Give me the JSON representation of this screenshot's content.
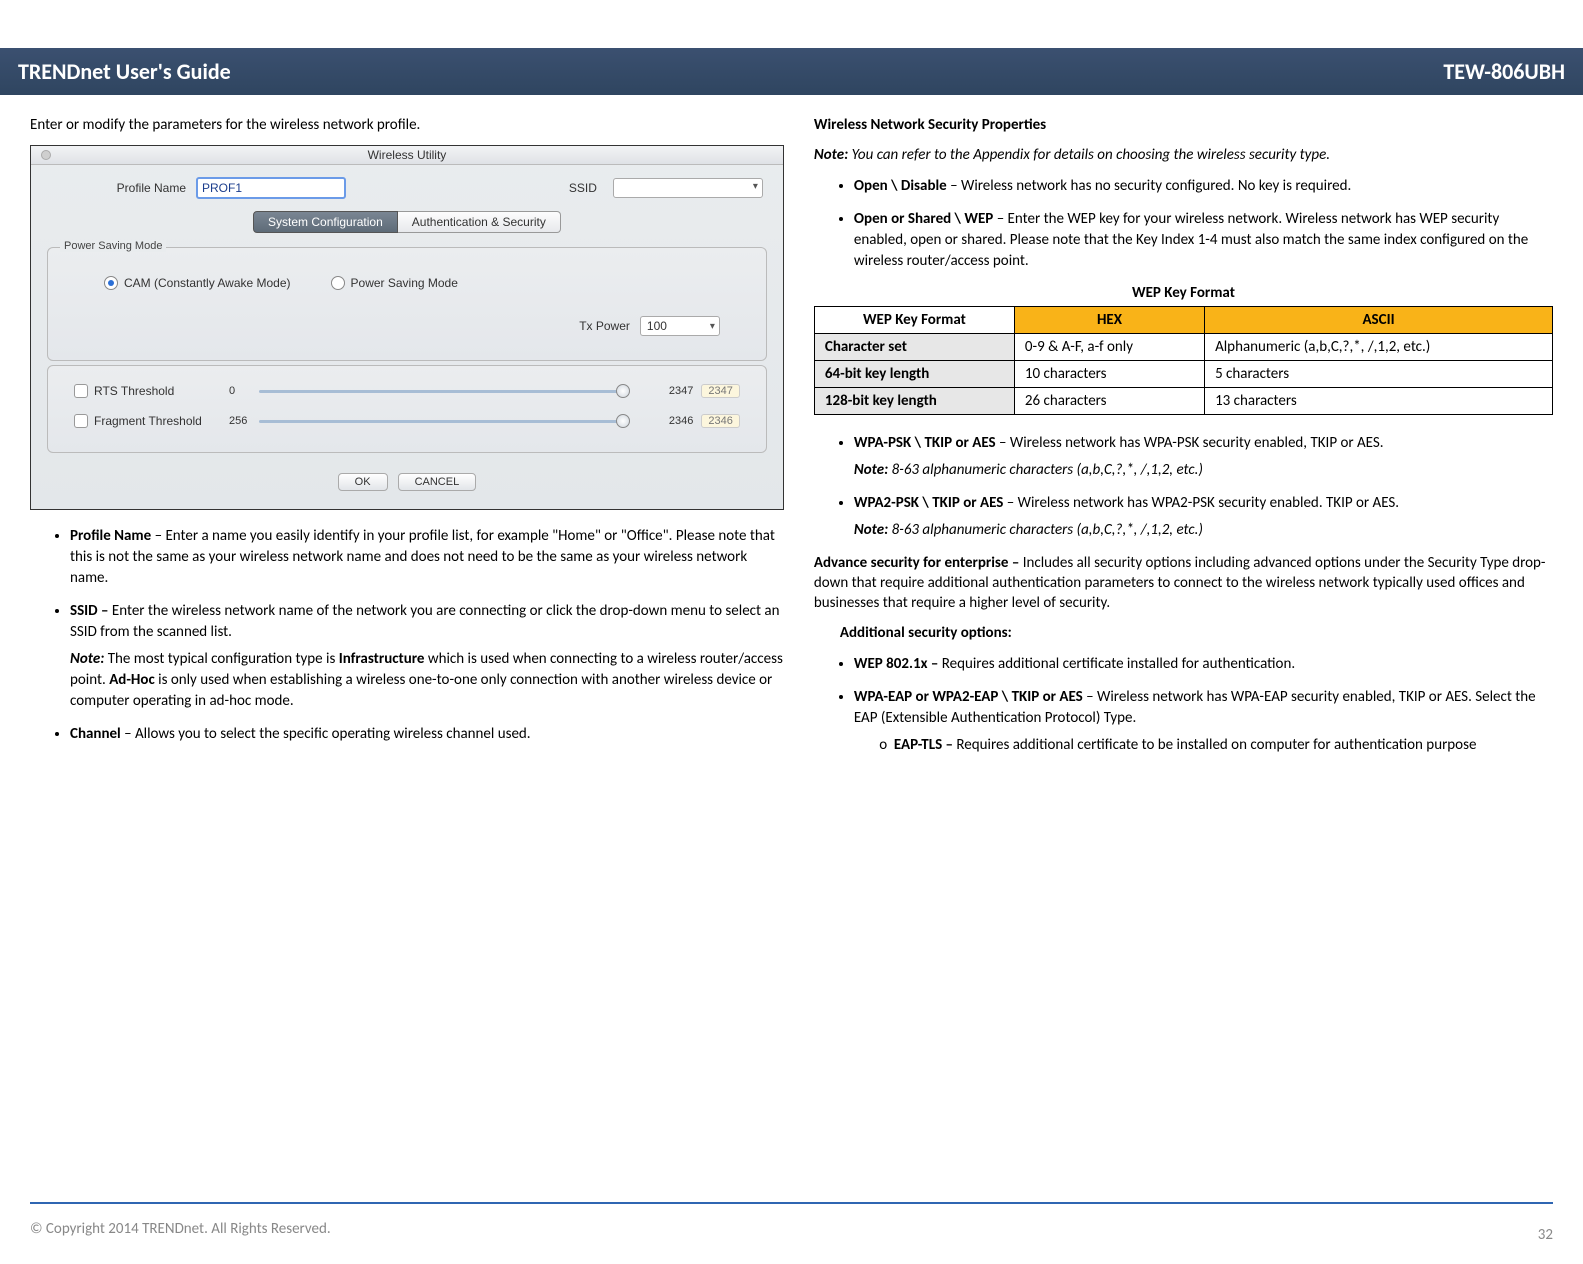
{
  "header": {
    "title": "TRENDnet User's Guide",
    "model": "TEW-806UBH"
  },
  "left": {
    "intro": "Enter or modify the parameters for the wireless network profile.",
    "shot": {
      "windowTitle": "Wireless Utility",
      "profileNameLabel": "Profile Name",
      "profileNameValue": "PROF1",
      "ssidLabel": "SSID",
      "tabSystem": "System Configuration",
      "tabAuth": "Authentication & Security",
      "powerGroupLabel": "Power Saving Mode",
      "radioCam": "CAM (Constantly Awake Mode)",
      "radioPsm": "Power Saving Mode",
      "txPowerLabel": "Tx Power",
      "txPowerValue": "100",
      "rtsLabel": "RTS Threshold",
      "fragLabel": "Fragment Threshold",
      "rtsMin": "0",
      "rtsMax": "2347",
      "rtsVal": "2347",
      "fragMin": "256",
      "fragMax": "2346",
      "fragVal": "2346",
      "okBtn": "OK",
      "cancelBtn": "CANCEL"
    },
    "bullets": {
      "profileName_h": "Profile Name",
      "profileName_b": " – Enter a name you easily identify in your profile list, for example \"Home\" or \"Office\". Please note that this is not the same as your wireless network name and does not need to be the same as your wireless network name.",
      "ssid_h": "SSID – ",
      "ssid_b": "Enter the wireless network name of the network you are connecting or click the drop-down menu to select an SSID from the scanned list.",
      "ssid_note_h": "Note:",
      "ssid_note_b1": " The most typical configuration type is ",
      "ssid_note_infra": "Infrastructure",
      "ssid_note_b2": " which is used when connecting to a wireless router/access point. ",
      "ssid_note_adhoc": "Ad-Hoc",
      "ssid_note_b3": " is only used when establishing a wireless one-to-one only connection with another wireless device or computer operating in ad-hoc mode.",
      "channel_h": "Channel",
      "channel_b": " – Allows you to select the specific operating wireless channel used."
    }
  },
  "right": {
    "h1": "Wireless Network Security Properties",
    "note_h": "Note:",
    "note_b": " You can refer to the Appendix for details on choosing the wireless security type.",
    "open_h": "Open \\ Disable",
    "open_b": " – Wireless network has no security configured. No key is required.",
    "wep_h": "Open or Shared \\ WEP",
    "wep_b": " – Enter the WEP key for your wireless network. Wireless network has WEP security enabled, open or shared. Please note that the Key Index 1-4 must also match the same index configured on the wireless router/access point.",
    "tbl_caption": "WEP Key Format",
    "tbl": {
      "h1": "WEP Key Format",
      "h2": "HEX",
      "h3": "ASCII",
      "r1c1": "Character set",
      "r1c2": "0-9 & A-F, a-f only",
      "r1c3": "Alphanumeric (a,b,C,?,*, /,1,2, etc.)",
      "r2c1": "64-bit key length",
      "r2c2": "10 characters",
      "r2c3": "5 characters",
      "r3c1": "128-bit key length",
      "r3c2": "26 characters",
      "r3c3": "13 characters"
    },
    "wpa_h": "WPA-PSK \\ TKIP or AES",
    "wpa_b": " – Wireless network has WPA-PSK security enabled, TKIP or AES.",
    "wpa_note": " 8-63 alphanumeric characters (a,b,C,?,*, /,1,2, etc.)",
    "wpa2_h": "WPA2-PSK \\ TKIP or AES",
    "wpa2_b": " – Wireless network has WPA2-PSK security  enabled. TKIP or AES.",
    "wpa2_note": " 8-63 alphanumeric characters (a,b,C,?,*, /,1,2, etc.)",
    "adv_h": "Advance security for enterprise – ",
    "adv_b": "Includes all security options including advanced options under the Security Type drop-down that require additional authentication parameters to connect to the wireless network typically used offices and businesses that require a higher level of security.",
    "addl_h": "Additional security options:",
    "wep8021_h": "WEP 802.1x – ",
    "wep8021_b": "Requires additional certificate installed for authentication.",
    "eap_h": "WPA-EAP or WPA2-EAP \\ TKIP or AES",
    "eap_b": " – Wireless network has WPA-EAP security enabled, TKIP or AES. Select the EAP (Extensible Authentication Protocol) Type.",
    "eaptls_h": "EAP-TLS – ",
    "eaptls_b": "Requires additional certificate to be installed on computer for authentication purpose"
  },
  "footer": {
    "copyright": "© Copyright 2014 TRENDnet. All Rights Reserved.",
    "page": "32"
  }
}
